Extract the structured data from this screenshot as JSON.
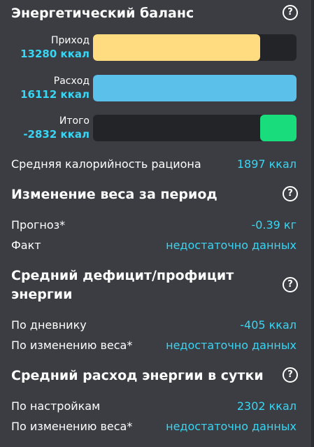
{
  "energy_balance": {
    "title": "Энергетический баланс",
    "intake": {
      "label": "Приход",
      "value": "13280 ккал",
      "fill_fraction": 0.82
    },
    "expense": {
      "label": "Расход",
      "value": "16112 ккал",
      "fill_fraction": 1.0
    },
    "total": {
      "label": "Итого",
      "value": "-2832 ккал",
      "fill_fraction": 0.18
    },
    "avg_label": "Средняя калорийность рациона",
    "avg_value": "1897 ккал",
    "colors": {
      "intake": "#ffdc7f",
      "expense": "#5bc0ea",
      "total": "#19dc7c"
    }
  },
  "weight_change": {
    "title": "Изменение веса за период",
    "forecast_label": "Прогноз*",
    "forecast_value": "-0.39 кг",
    "fact_label": "Факт",
    "fact_value": "недостаточно данных"
  },
  "avg_deficit": {
    "title_line1": "Средний дефицит/профицит",
    "title_line2": "энергии",
    "diary_label": "По дневнику",
    "diary_value": "-405 ккал",
    "weight_label": "По изменению веса*",
    "weight_value": "недостаточно данных"
  },
  "avg_expense": {
    "title": "Средний расход энергии в сутки",
    "settings_label": "По настройкам",
    "settings_value": "2302 ккал",
    "weight_label": "По изменению веса*",
    "weight_value": "недостаточно данных"
  },
  "help_icon_glyph": "?"
}
